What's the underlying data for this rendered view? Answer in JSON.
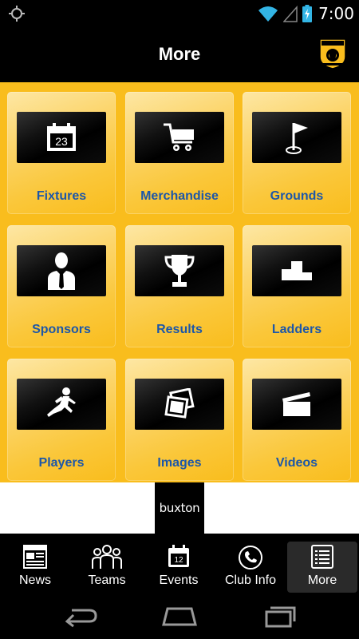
{
  "status_bar": {
    "time": "7:00",
    "left_icon": "gps-crosshair-icon",
    "icons": [
      "wifi-icon",
      "signal-icon",
      "battery-icon"
    ]
  },
  "header": {
    "title": "More",
    "logo_icon": "club-crest-icon"
  },
  "tiles": [
    {
      "label": "Fixtures",
      "icon": "calendar-icon",
      "calendar_day": "23"
    },
    {
      "label": "Merchandise",
      "icon": "cart-icon"
    },
    {
      "label": "Grounds",
      "icon": "flag-icon"
    },
    {
      "label": "Sponsors",
      "icon": "businessman-icon"
    },
    {
      "label": "Results",
      "icon": "trophy-icon"
    },
    {
      "label": "Ladders",
      "icon": "podium-icon"
    },
    {
      "label": "Players",
      "icon": "player-icon"
    },
    {
      "label": "Images",
      "icon": "photos-icon"
    },
    {
      "label": "Videos",
      "icon": "clapperboard-icon"
    }
  ],
  "sponsor": {
    "logo_text": "buxton"
  },
  "tabs": [
    {
      "label": "News",
      "icon": "newspaper-icon"
    },
    {
      "label": "Teams",
      "icon": "group-icon"
    },
    {
      "label": "Events",
      "icon": "calendar-icon",
      "calendar_day": "12"
    },
    {
      "label": "Club Info",
      "icon": "phone-icon"
    },
    {
      "label": "More",
      "icon": "list-icon",
      "active": true
    }
  ],
  "navbar": {
    "icons": [
      "back-icon",
      "home-icon",
      "recent-apps-icon"
    ]
  },
  "colors": {
    "grid_background": "#f9bd1d",
    "label_blue": "#1d57a8",
    "bar_background": "#000000"
  }
}
